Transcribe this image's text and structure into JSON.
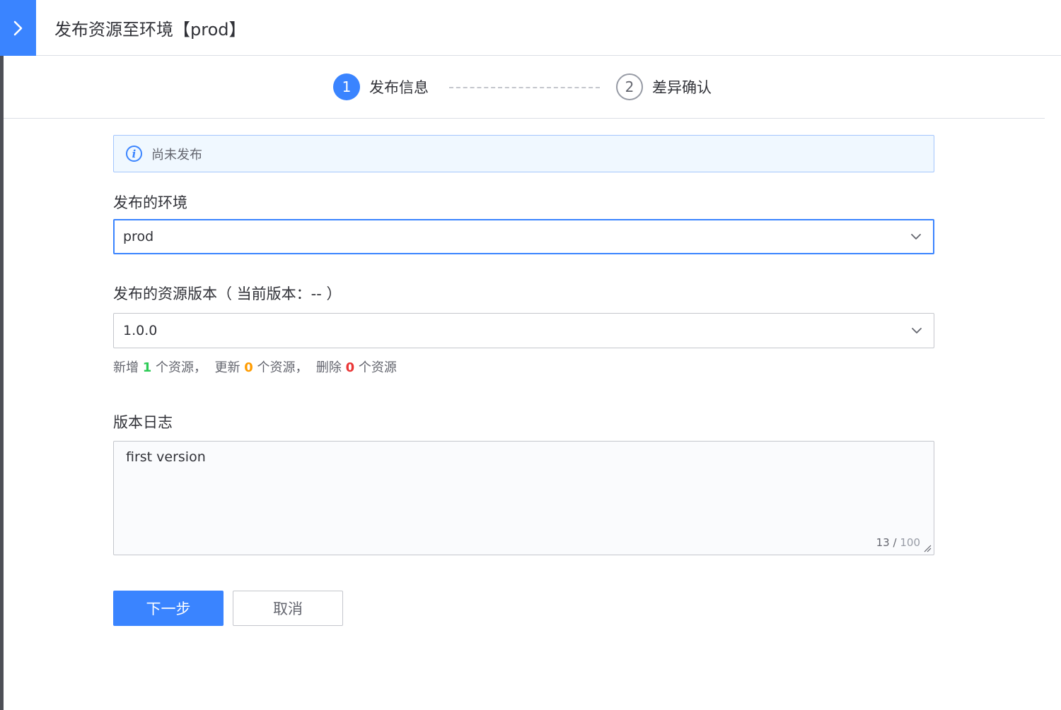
{
  "header": {
    "collapse_icon": "chevron-right-icon",
    "title": "发布资源至环境【prod】"
  },
  "steps": [
    {
      "number": "1",
      "label": "发布信息",
      "state": "active"
    },
    {
      "number": "2",
      "label": "差异确认",
      "state": "pending"
    }
  ],
  "info": {
    "icon": "info-icon",
    "text": "尚未发布"
  },
  "environment": {
    "label": "发布的环境",
    "value": "prod"
  },
  "version": {
    "label": "发布的资源版本（ 当前版本：-- ）",
    "value": "1.0.0"
  },
  "summary": {
    "prefix_added": "新增",
    "added": "1",
    "unit_added": "个资源，",
    "prefix_updated": "更新",
    "updated": "0",
    "unit_updated": "个资源，",
    "prefix_deleted": "删除",
    "deleted": "0",
    "unit_deleted": "个资源"
  },
  "log": {
    "label": "版本日志",
    "value": "first version",
    "count": "13",
    "separator": "/",
    "max": "100"
  },
  "buttons": {
    "next": "下一步",
    "cancel": "取消"
  },
  "colors": {
    "primary": "#3a84ff",
    "added": "#2dcb56",
    "updated": "#ff9c01",
    "deleted": "#ea3636"
  }
}
